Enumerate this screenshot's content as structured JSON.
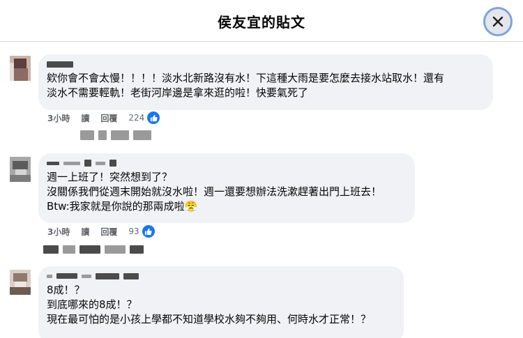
{
  "header": {
    "title": "侯友宜的貼文",
    "close_icon": "close-icon"
  },
  "comments": [
    {
      "text": "欸你會不會太慢！！！！淡水北新路沒有水！下這種大雨是要怎麼去接水站取水！還有\n淡水不需要輕軌！老街河岸邊是拿來逛的啦！快要氣死了",
      "time": "3小時",
      "read": "讀",
      "reply": "回覆",
      "likes": "224"
    },
    {
      "text": "週一上班了！突然想到了？\n沒關係我們從週末開始就沒水啦！週一還要想辦法洗漱趕著出門上班去！\nBtw:我家就是你說的那兩成啦😤",
      "time": "3小時",
      "read": "讀",
      "reply": "回覆",
      "likes": "93"
    },
    {
      "text": "8成！？\n到底哪來的8成！？\n現在最可怕的是小孩上學都不知道學校水夠不夠用、何時水才正常！？"
    }
  ],
  "colors": {
    "accent": "#1877f2",
    "bubble": "#f0f2f5",
    "meta": "#65676b"
  }
}
